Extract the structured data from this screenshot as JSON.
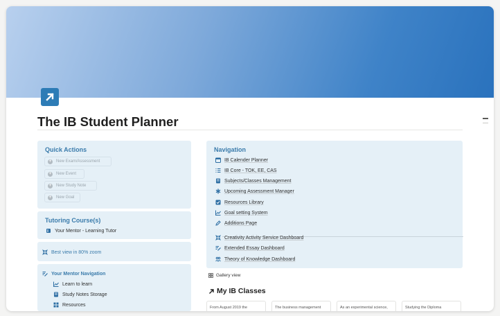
{
  "page": {
    "title": "The IB Student Planner",
    "accent_color": "#2d7cb6",
    "box_color": "#e5f0f7",
    "icon": "arrow-up-right-icon"
  },
  "quick_actions": {
    "title": "Quick Actions",
    "buttons": [
      {
        "label": "New Exam/Assessment",
        "icon": "plus-icon"
      },
      {
        "label": "New Event",
        "icon": "plus-icon"
      },
      {
        "label": "New Study Note",
        "icon": "plus-icon"
      },
      {
        "label": "New Goal",
        "icon": "plus-icon"
      }
    ]
  },
  "tutoring": {
    "title": "Tutoring Course(s)",
    "items": [
      {
        "label": "Your Mentor - Learning Tutor",
        "icon": "book-icon"
      }
    ]
  },
  "zoom_note": {
    "label": "Best view in 80% zoom",
    "icon": "shrink-icon"
  },
  "mentor_nav": {
    "title": "Your Mentor Navigation",
    "icon": "list-edit-icon",
    "items": [
      {
        "label": "Learn to learn",
        "icon": "chart-icon"
      },
      {
        "label": "Study Notes Storage",
        "icon": "notes-icon"
      },
      {
        "label": "Resources",
        "icon": "grid-icon"
      }
    ]
  },
  "navigation": {
    "title": "Navigation",
    "items": [
      {
        "label": "IB Calender Planner",
        "icon": "calendar-icon"
      },
      {
        "label": "IB Core - TOK, EE, CAS",
        "icon": "list-icon"
      },
      {
        "label": "Subjects/Classes Management",
        "icon": "notes-icon"
      },
      {
        "label": "Upcoming Assessment Manager",
        "icon": "asterisk-icon"
      },
      {
        "label": "Resources Library",
        "icon": "checkbox-icon"
      },
      {
        "label": "Goal setting System",
        "icon": "chart-icon"
      },
      {
        "label": "Additions Page",
        "icon": "pencil-icon"
      }
    ],
    "dashboards": [
      {
        "label": "Creativity Activity Service Dashboard",
        "icon": "grid-icon"
      },
      {
        "label": "Extended Essay Dashboard",
        "icon": "list-edit-icon"
      },
      {
        "label": "Theory of Knowledge Dashboard",
        "icon": "people-icon"
      }
    ]
  },
  "gallery": {
    "label": "Gallery view",
    "icon": "gallery-icon"
  },
  "classes": {
    "title": "My IB Classes",
    "icon": "arrow-up-right-icon",
    "cards": [
      {
        "text": "From August 2019 the"
      },
      {
        "text": "The business management"
      },
      {
        "text": "As an experimental science,"
      },
      {
        "text": "Studying the Diploma"
      }
    ]
  }
}
